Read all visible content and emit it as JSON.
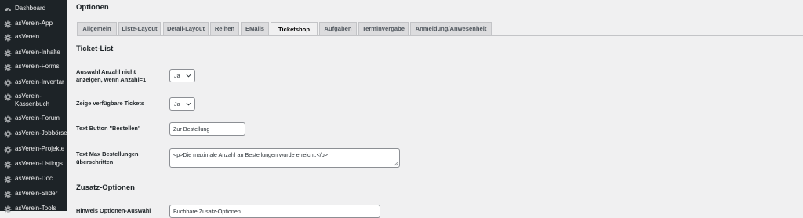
{
  "sidebar": {
    "items": [
      {
        "label": "Dashboard",
        "icon": "dashboard-icon"
      },
      {
        "label": "asVerein-App",
        "icon": "gear-icon"
      },
      {
        "label": "asVerein",
        "icon": "gear-icon"
      },
      {
        "label": "asVerein-Inhalte",
        "icon": "gear-icon"
      },
      {
        "label": "asVerein-Forms",
        "icon": "gear-icon"
      },
      {
        "label": "asVerein-Inventar",
        "icon": "gear-icon"
      },
      {
        "label": "asVerein-\nKassenbuch",
        "icon": "gear-icon"
      },
      {
        "label": "asVerein-Forum",
        "icon": "gear-icon"
      },
      {
        "label": "asVerein-Jobbörse",
        "icon": "gear-icon"
      },
      {
        "label": "asVerein-Projekte",
        "icon": "gear-icon"
      },
      {
        "label": "asVerein-Listings",
        "icon": "gear-icon"
      },
      {
        "label": "asVerein-Doc",
        "icon": "gear-icon"
      },
      {
        "label": "asVerein-Slider",
        "icon": "gear-icon"
      },
      {
        "label": "asVerein-Tools",
        "icon": "gear-icon"
      }
    ]
  },
  "main": {
    "heading": "Optionen",
    "tabs": [
      {
        "label": "Allgemein"
      },
      {
        "label": "Liste-Layout"
      },
      {
        "label": "Detail-Layout"
      },
      {
        "label": "Reihen"
      },
      {
        "label": "EMails"
      },
      {
        "label": "Ticketshop"
      },
      {
        "label": "Aufgaben"
      },
      {
        "label": "Terminvergabe"
      },
      {
        "label": "Anmeldung/Anwesenheit"
      }
    ],
    "active_tab": "Ticketshop",
    "section1_title": "Ticket-List",
    "fields": {
      "auswahl_anzahl": {
        "label": "Auswahl Anzahl nicht anzeigen, wenn Anzahl=1",
        "value": "Ja"
      },
      "zeige_tickets": {
        "label": "Zeige verfügbare Tickets",
        "value": "Ja"
      },
      "text_button": {
        "label": "Text Button \"Bestellen\"",
        "value": "Zur Bestellung"
      },
      "text_max": {
        "label": "Text Max Bestellungen überschritten",
        "value": "<p>Die maximale Anzahl an Bestellungen wurde erreicht.</p>"
      }
    },
    "section2_title": "Zusatz-Optionen",
    "zusatz": {
      "label": "Hinweis Optionen-Auswahl",
      "value": "Buchbare Zusatz-Optionen"
    }
  },
  "colors": {
    "sidebar_bg": "#1d2327",
    "page_bg": "#f0f0f1",
    "tab_bg": "#dcdcde",
    "border": "#8c8f94"
  }
}
